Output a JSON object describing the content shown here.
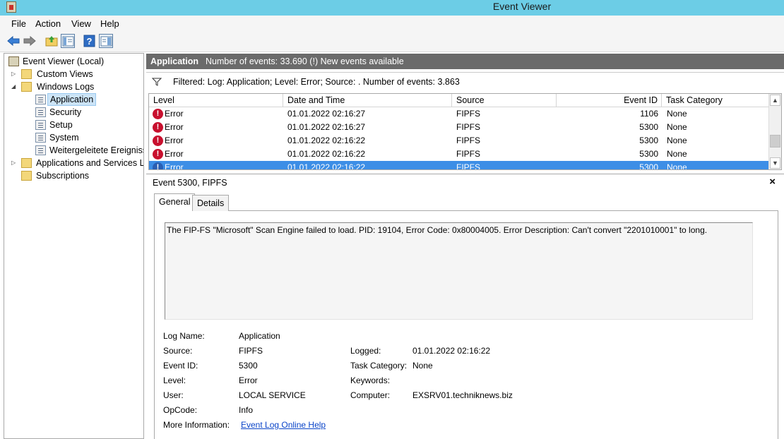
{
  "window": {
    "title": "Event Viewer"
  },
  "menu": [
    "File",
    "Action",
    "View",
    "Help"
  ],
  "tree": {
    "root": "Event Viewer (Local)",
    "custom_views": "Custom Views",
    "windows_logs": "Windows Logs",
    "logs": [
      "Application",
      "Security",
      "Setup",
      "System",
      "Weitergeleitete Ereignisse"
    ],
    "apps_services": "Applications and Services Lo",
    "subscriptions": "Subscriptions"
  },
  "header": {
    "log_name": "Application",
    "summary": "Number of events: 33.690 (!) New events available"
  },
  "filter": {
    "text": "Filtered: Log: Application; Level: Error; Source: . Number of events: 3.863"
  },
  "table": {
    "columns": [
      "Level",
      "Date and Time",
      "Source",
      "Event ID",
      "Task Category"
    ],
    "rows": [
      {
        "level": "Error",
        "date": "01.01.2022 02:16:27",
        "source": "FIPFS",
        "event_id": "1106",
        "category": "None"
      },
      {
        "level": "Error",
        "date": "01.01.2022 02:16:27",
        "source": "FIPFS",
        "event_id": "5300",
        "category": "None"
      },
      {
        "level": "Error",
        "date": "01.01.2022 02:16:22",
        "source": "FIPFS",
        "event_id": "5300",
        "category": "None"
      },
      {
        "level": "Error",
        "date": "01.01.2022 02:16:22",
        "source": "FIPFS",
        "event_id": "5300",
        "category": "None"
      },
      {
        "level": "Error",
        "date": "01.01.2022 02:16:22",
        "source": "FIPFS",
        "event_id": "5300",
        "category": "None"
      }
    ]
  },
  "detail": {
    "title": "Event 5300, FIPFS",
    "close": "×",
    "tabs": [
      "General",
      "Details"
    ],
    "description": "The FIP-FS \"Microsoft\" Scan Engine failed to load. PID: 19104, Error Code: 0x80004005. Error Description: Can't convert \"2201010001\" to long.",
    "labels": {
      "log_name": "Log Name:",
      "source": "Source:",
      "event_id": "Event ID:",
      "level": "Level:",
      "user": "User:",
      "opcode": "OpCode:",
      "more_info": "More Information:",
      "logged": "Logged:",
      "task_category": "Task Category:",
      "keywords": "Keywords:",
      "computer": "Computer:"
    },
    "values": {
      "log_name": "Application",
      "source": "FIPFS",
      "event_id": "5300",
      "level": "Error",
      "user": "LOCAL SERVICE",
      "opcode": "Info",
      "more_info_link": "Event Log Online Help",
      "logged": "01.01.2022 02:16:22",
      "task_category": "None",
      "keywords": "",
      "computer": "EXSRV01.techniknews.biz"
    }
  }
}
